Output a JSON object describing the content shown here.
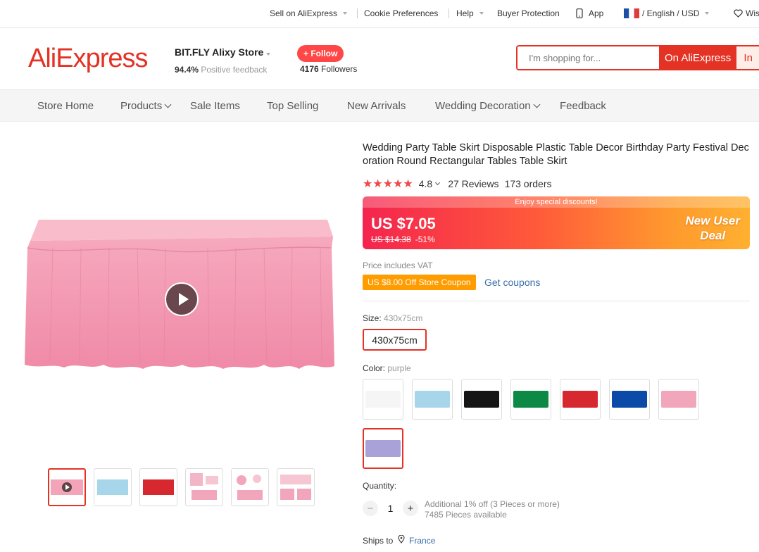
{
  "topbar": {
    "sell": "Sell on AliExpress",
    "cookie": "Cookie Preferences",
    "help": "Help",
    "protection": "Buyer Protection",
    "app": "App",
    "lang": "/ English / USD",
    "wish": "Wis"
  },
  "header": {
    "logo": "AliExpress",
    "store_name": "BIT.FLY Alixy Store",
    "feedback_pct": "94.4%",
    "feedback_label": "Positive feedback",
    "follow_label": "+ Follow",
    "followers_count": "4176",
    "followers_label": "Followers",
    "search_placeholder": "I'm shopping for...",
    "search_btn": "On AliExpress",
    "search_btn2": "In"
  },
  "nav": {
    "items": [
      "Store Home",
      "Products",
      "Sale Items",
      "Top Selling",
      "New Arrivals",
      "Wedding Decoration",
      "Feedback"
    ]
  },
  "product": {
    "title": "Wedding Party Table Skirt Disposable Plastic Table Decor Birthday Party Festival Decoration Round Rectangular Tables Table Skirt",
    "stars": "★★★★★",
    "rating": "4.8",
    "reviews": "27 Reviews",
    "orders": "173 orders",
    "banner": "Enjoy special discounts!",
    "price": "US $7.05",
    "old_price": "US $14.38",
    "discount": "-51%",
    "deal_line1": "New User",
    "deal_line2": "Deal",
    "vat": "Price includes VAT",
    "coupon": "US $8.00 Off Store Coupon",
    "get_coupons": "Get coupons",
    "size_label": "Size:",
    "size_value": "430x75cm",
    "size_option": "430x75cm",
    "color_label": "Color:",
    "color_value": "purple",
    "colors": [
      "#f5f5f5",
      "#a7d6ea",
      "#151515",
      "#0c8a45",
      "#d7272f",
      "#0c4aa8",
      "#f2a6bb",
      "#a9a2d8"
    ],
    "quantity_label": "Quantity:",
    "quantity": "1",
    "qty_minus": "−",
    "qty_plus": "+",
    "qty_discount": "Additional 1% off (3 Pieces or more)",
    "available": "7485 Pieces available",
    "ships_to_label": "Ships to",
    "ships_to": "France"
  }
}
